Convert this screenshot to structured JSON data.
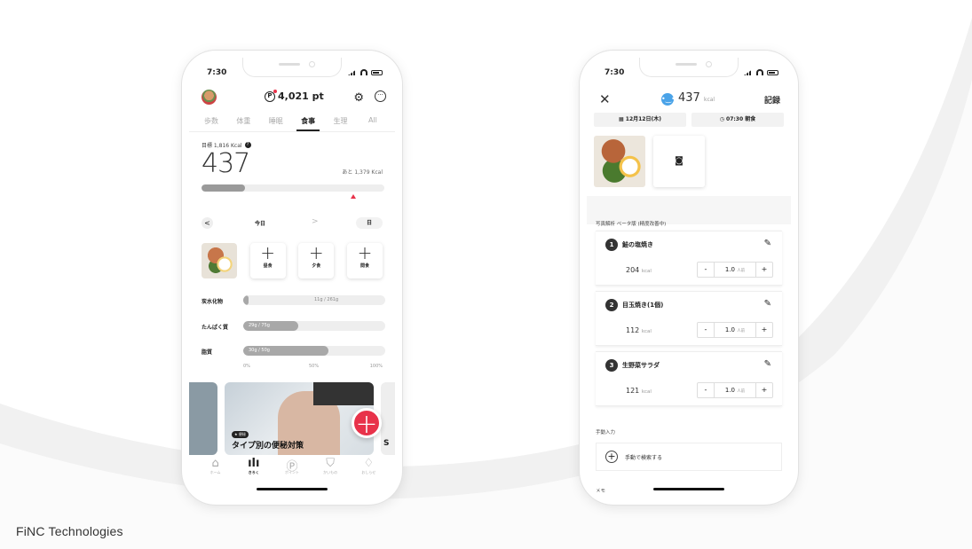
{
  "brand": "FiNC Technologies",
  "phone1": {
    "status_time": "7:30",
    "points": "4,021 pt",
    "points_icon": "P",
    "tabs": [
      "歩数",
      "体重",
      "睡眠",
      "食事",
      "生理",
      "All"
    ],
    "active_tab": 3,
    "goal": "目標 1,816 Kcal",
    "goal_help": "?",
    "kcal": "437",
    "remaining": "あと 1,379 Kcal",
    "calorie_progress": 0.24,
    "day_prev": "<",
    "day_label": "今日",
    "day_next": ">",
    "day_button": "日",
    "meals": [
      {
        "label": "昼食",
        "plus": "+"
      },
      {
        "label": "夕食",
        "plus": "+"
      },
      {
        "label": "間食",
        "plus": "+"
      }
    ],
    "nutrients": [
      {
        "name": "炭水化物",
        "value": "11g / 261g",
        "ratio": 0.04
      },
      {
        "name": "たんぱく質",
        "value": "29g / 75g",
        "ratio": 0.39
      },
      {
        "name": "脂質",
        "value": "30g / 50g",
        "ratio": 0.6
      }
    ],
    "scale": [
      "0%",
      "50%",
      "100%"
    ],
    "banner_tag": "★ 便秘",
    "banner_title": "タイプ別の便秘対策",
    "banner_next_initial": "S",
    "fab": "+",
    "nav": [
      {
        "label": "ホーム",
        "icon": "⌂"
      },
      {
        "label": "きろく",
        "icon": "ılı"
      },
      {
        "label": "ポイント",
        "icon": "Ⓟ"
      },
      {
        "label": "かいもの",
        "icon": "⛉"
      },
      {
        "label": "おしらせ",
        "icon": "♢"
      }
    ],
    "colors": {
      "accent": "#e8324a"
    }
  },
  "phone2": {
    "status_time": "7:30",
    "close": "✕",
    "face": "•‿•",
    "kcal": "437",
    "kcal_unit": "kcal",
    "save": "記録",
    "date": "▦ 12月12日(木)",
    "time": "◷ 07:30 朝食",
    "camera": "◙",
    "analysis_label": "写真解析  ベータ版 (精度改善中)",
    "foods": [
      {
        "num": "1",
        "name": "鮭の塩焼き",
        "kcal": "204",
        "unit": "kcal",
        "qty": "1.0",
        "qty_unit": "人前"
      },
      {
        "num": "2",
        "name": "目玉焼き(1個)",
        "kcal": "112",
        "unit": "kcal",
        "qty": "1.0",
        "qty_unit": "人前"
      },
      {
        "num": "3",
        "name": "生野菜サラダ",
        "kcal": "121",
        "unit": "kcal",
        "qty": "1.0",
        "qty_unit": "人前"
      }
    ],
    "minus": "-",
    "plus": "+",
    "edit_icon": "✎",
    "manual_label": "手動入力",
    "manual_plus": "+",
    "manual_search": "手動で検索する",
    "memo_label": "メモ"
  }
}
